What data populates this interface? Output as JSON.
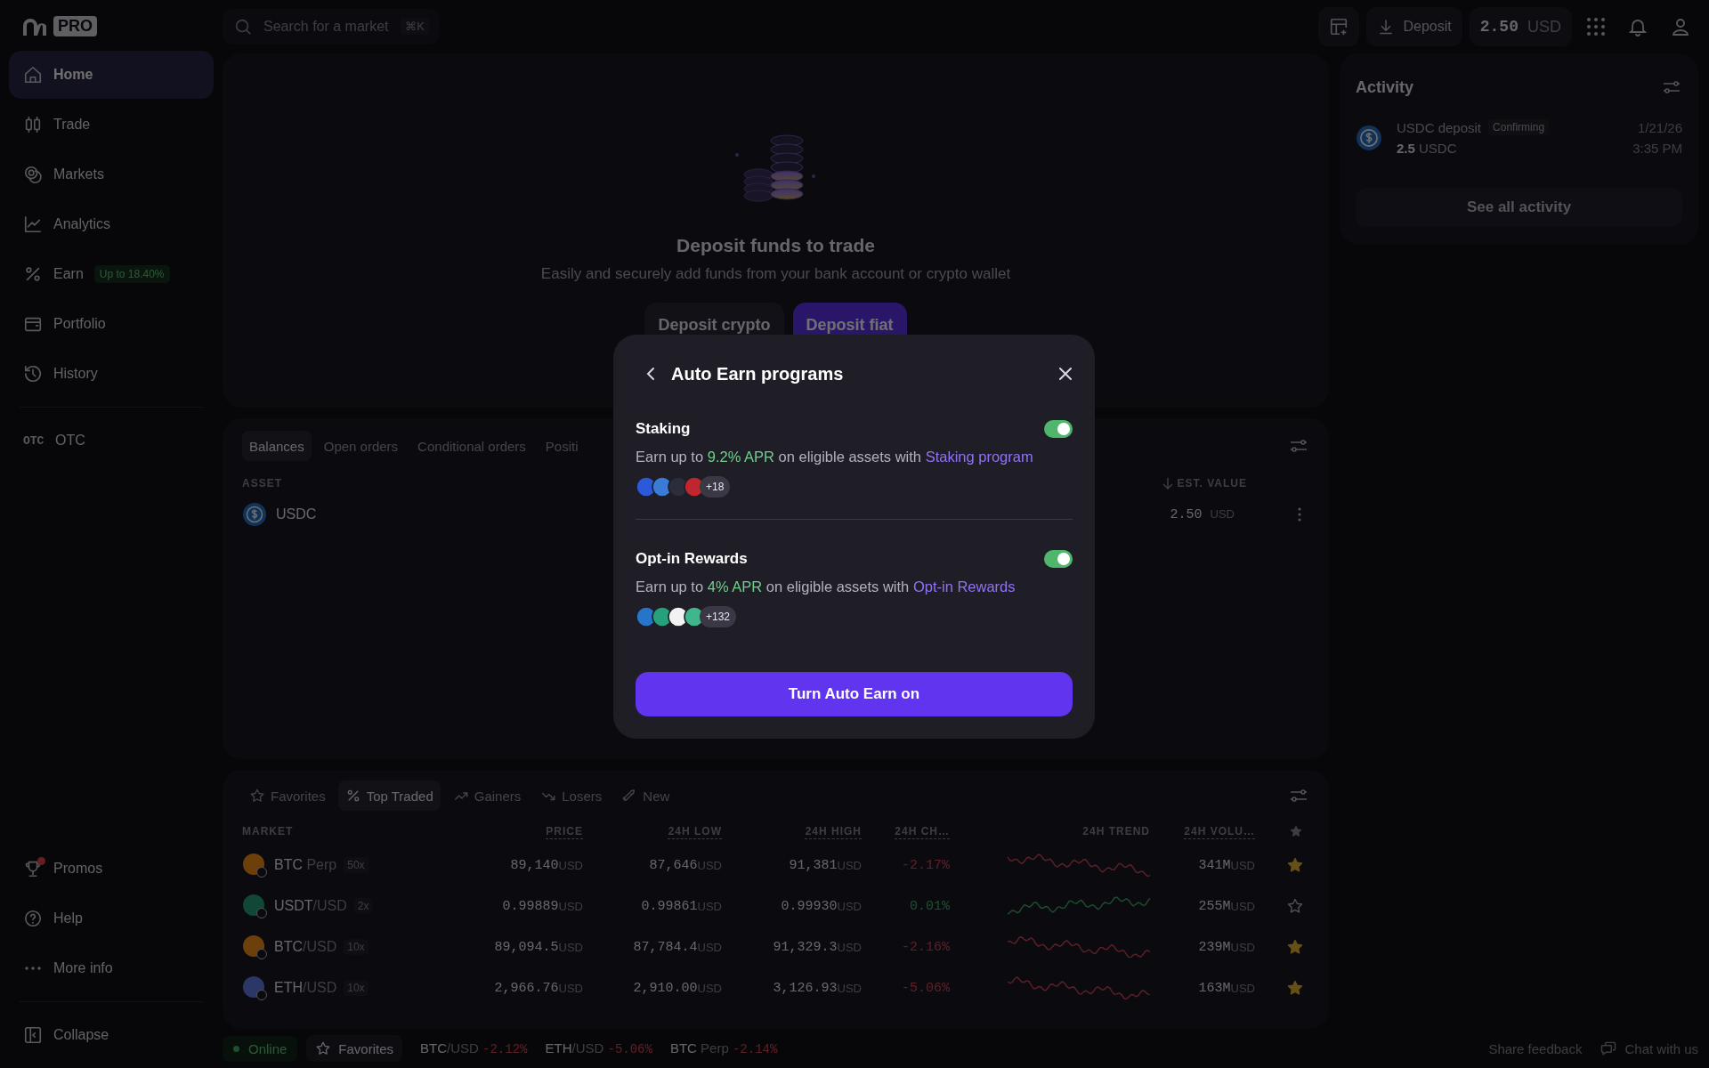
{
  "sidebar": {
    "logo_badge": "PRO",
    "items": [
      {
        "label": "Home",
        "selected": true
      },
      {
        "label": "Trade",
        "selected": false
      },
      {
        "label": "Markets",
        "selected": false
      },
      {
        "label": "Analytics",
        "selected": false
      },
      {
        "label": "Earn",
        "selected": false,
        "badge": "Up to 18.40%"
      },
      {
        "label": "Portfolio",
        "selected": false
      },
      {
        "label": "History",
        "selected": false
      }
    ],
    "extra_items": [
      {
        "icon_text": "OTC",
        "label": "OTC",
        "selected": false
      }
    ],
    "footer_items": [
      {
        "label": "Promos",
        "notification": true
      },
      {
        "label": "Help",
        "notification": false
      },
      {
        "label": "More info",
        "notification": false
      }
    ],
    "collapse": "Collapse"
  },
  "top_bar": {
    "search": {
      "placeholder": "Search for a market",
      "shortcut": "⌘K"
    },
    "deposit": "Deposit",
    "balance": {
      "amount": "2.50",
      "currency": "USD"
    }
  },
  "hero": {
    "title": "Deposit funds to trade",
    "subtitle": "Easily and securely add funds from your bank account or crypto wallet",
    "buttons": [
      {
        "label": "Deposit crypto",
        "kind": "secondary"
      },
      {
        "label": "Deposit fiat",
        "kind": "primary"
      }
    ]
  },
  "balances": {
    "tabs": [
      {
        "label": "Balances",
        "selected": true
      },
      {
        "label": "Open orders",
        "selected": false
      },
      {
        "label": "Conditional orders",
        "selected": false
      },
      {
        "label": "Positi",
        "selected": false
      }
    ],
    "columns": [
      "ASSET",
      "EST. VALUE"
    ],
    "rows": [
      {
        "asset": "USDC",
        "value": "2.50",
        "unit": "USD"
      }
    ]
  },
  "activity": {
    "title": "Activity",
    "items": [
      {
        "title": "USDC deposit",
        "status": "Confirming",
        "amount": "2.5",
        "unit": "USDC",
        "date": "1/21/26",
        "time": "3:35 PM"
      }
    ],
    "button": "See all activity"
  },
  "markets": {
    "tabs": [
      {
        "label": "Favorites",
        "selected": false
      },
      {
        "label": "Top Traded",
        "selected": true
      },
      {
        "label": "Gainers",
        "selected": false
      },
      {
        "label": "Losers",
        "selected": false
      },
      {
        "label": "New",
        "selected": false
      }
    ],
    "columns": [
      "MARKET",
      "PRICE",
      "24H LOW",
      "24H HIGH",
      "24H CH…",
      "24H TREND",
      "24H VOLU…"
    ],
    "rows": [
      {
        "name": "BTC",
        "suffix": "Perp",
        "leverage": "50x",
        "price": "89,140",
        "price_unit": "USD",
        "low": "87,646",
        "low_unit": "USD",
        "high": "91,381",
        "high_unit": "USD",
        "change": "-2.17%",
        "negative": true,
        "volume": "341M",
        "volume_unit": "USD",
        "favorite": true
      },
      {
        "name": "USDT",
        "suffix": "/USD",
        "leverage": "2x",
        "price": "0.99889",
        "price_unit": "USD",
        "low": "0.99861",
        "low_unit": "USD",
        "high": "0.99930",
        "high_unit": "USD",
        "change": "0.01%",
        "negative": false,
        "volume": "255M",
        "volume_unit": "USD",
        "favorite": false
      },
      {
        "name": "BTC",
        "suffix": "/USD",
        "leverage": "10x",
        "price": "89,094.5",
        "price_unit": "USD",
        "low": "87,784.4",
        "low_unit": "USD",
        "high": "91,329.3",
        "high_unit": "USD",
        "change": "-2.16%",
        "negative": true,
        "volume": "239M",
        "volume_unit": "USD",
        "favorite": true
      },
      {
        "name": "ETH",
        "suffix": "/USD",
        "leverage": "10x",
        "price": "2,966.76",
        "price_unit": "USD",
        "low": "2,910.00",
        "low_unit": "USD",
        "high": "3,126.93",
        "high_unit": "USD",
        "change": "-5.06%",
        "negative": true,
        "volume": "163M",
        "volume_unit": "USD",
        "favorite": true
      }
    ]
  },
  "status_bar": {
    "connection": "Online",
    "online": true,
    "favorites": "Favorites",
    "tickers": [
      {
        "name": "BTC",
        "suffix": "/USD",
        "change": "-2.12%",
        "negative": true
      },
      {
        "name": "ETH",
        "suffix": "/USD",
        "change": "-5.06%",
        "negative": true
      },
      {
        "name": "BTC",
        "suffix": "Perp",
        "change": "-2.14%",
        "negative": true
      }
    ],
    "links": [
      "Share feedback",
      "Chat with us"
    ]
  },
  "modal": {
    "title": "Auto Earn programs",
    "programs": [
      {
        "name": "Staking",
        "on": true,
        "prefix": "Earn up to",
        "rate": "9.2% APR",
        "middle": "on eligible assets with",
        "link": "Staking program",
        "coins": [
          {
            "color": "#2a5ada"
          },
          {
            "color": "#3a7bd5"
          },
          {
            "color": "#2b2d3c"
          },
          {
            "color": "#c0262d"
          }
        ],
        "more": "+18"
      },
      {
        "name": "Opt-in Rewards",
        "on": true,
        "prefix": "Earn up to",
        "rate": "4% APR",
        "middle": "on eligible assets with",
        "link": "Opt-in Rewards",
        "coins": [
          {
            "color": "#2775ca"
          },
          {
            "color": "#26a17b"
          },
          {
            "color": "#f2f2f2"
          },
          {
            "color": "#3fb68b"
          }
        ],
        "more": "+132"
      }
    ],
    "button": "Turn Auto Earn on"
  }
}
